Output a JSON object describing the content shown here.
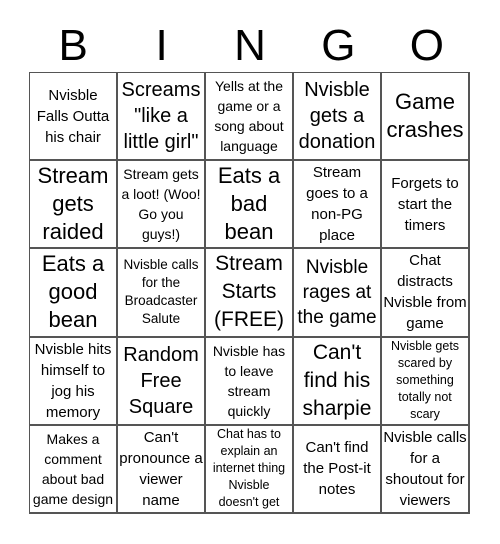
{
  "header": {
    "letters": [
      "B",
      "I",
      "N",
      "G",
      "O"
    ]
  },
  "board": {
    "rows": [
      [
        "Nvisble Falls Outta his chair",
        "Screams \"like a little girl\"",
        "Yells at the game or a song about language",
        "Nvisble gets a donation",
        "Game crashes"
      ],
      [
        "Stream gets raided",
        "Stream gets a loot! (Woo! Go you guys!)",
        "Eats a bad bean",
        "Stream goes to a non-PG place",
        "Forgets to start the timers"
      ],
      [
        "Eats a good bean",
        "Nvisble calls for the Broadcaster Salute",
        "Stream Starts (FREE)",
        "Nvisble rages at the game",
        "Chat distracts Nvisble from game"
      ],
      [
        "Nvisble hits himself to jog his memory",
        "Random Free Square",
        "Nvisble has to leave stream quickly",
        "Can't find his sharpie",
        "Nvisble gets scared by something totally not scary"
      ],
      [
        "Makes a comment about bad game design",
        "Can't pronounce a viewer name",
        "Chat has to explain an internet thing Nvisble doesn't get",
        "Can't find the Post-it notes",
        "Nvisble calls for a shoutout for viewers"
      ]
    ]
  }
}
